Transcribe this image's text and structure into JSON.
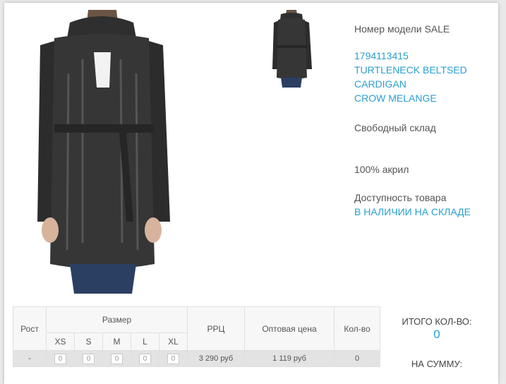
{
  "product": {
    "model_label": "Номер модели SALE",
    "sku": "1794113415",
    "name_lines": [
      "TURTLENECK BELTSED",
      "CARDIGAN",
      "CROW MELANGE"
    ],
    "warehouse": "Свободный склад",
    "composition": "100% акрил",
    "availability_label": "Доступность товара",
    "availability_value": "В НАЛИЧИИ НА СКЛАДЕ"
  },
  "table": {
    "headers": {
      "height": "Рост",
      "size": "Размер",
      "rrp": "РРЦ",
      "wholesale": "Оптовая цена",
      "qty": "Кол-во"
    },
    "sizes": [
      "XS",
      "S",
      "M",
      "L",
      "XL"
    ],
    "row": {
      "height": "-",
      "size_qty": [
        "0",
        "0",
        "0",
        "0",
        "0"
      ],
      "rrp": "3 290 руб",
      "wholesale": "1 119 руб",
      "qty": "0"
    }
  },
  "totals": {
    "qty_label": "ИТОГО КОЛ-ВО:",
    "qty_value": "0",
    "sum_label": "НА СУММУ:"
  }
}
